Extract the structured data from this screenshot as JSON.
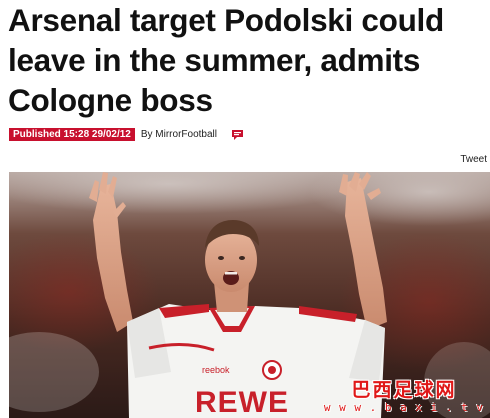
{
  "article": {
    "headline_lines": [
      "Arsenal target Podolski could",
      "leave in the summer, admits",
      "Cologne boss"
    ],
    "published_label": "Published 15:28 29/02/12",
    "byline": "By MirrorFootball"
  },
  "share": {
    "tweet_label": "Tweet"
  },
  "icons": {
    "comment": "comment-bubble-icon"
  },
  "photo": {
    "shirt_sponsor": "REWE",
    "shirt_brand": "reebok",
    "watermark_title": "巴西足球网",
    "watermark_url": "w w w . b a x i . t v"
  },
  "colors": {
    "published_badge": "#c8102e",
    "comment_icon": "#c8102e",
    "watermark": "#e01818"
  }
}
